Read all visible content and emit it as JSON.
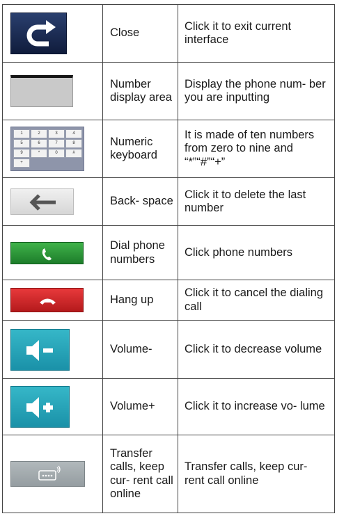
{
  "rows": [
    {
      "icon": "redo-arrow-icon",
      "name": "Close",
      "description": "Click it to exit current interface"
    },
    {
      "icon": "number-display-area-icon",
      "name": "Number display area",
      "description": "Display the phone num- ber you are inputting"
    },
    {
      "icon": "numeric-keypad-icon",
      "name": "Numeric keyboard",
      "description": "It is made of ten numbers from zero to nine and “*”“#”“+”"
    },
    {
      "icon": "backspace-arrow-icon",
      "name": "Back- space",
      "description": "Click it to delete the last number"
    },
    {
      "icon": "phone-icon",
      "name": "Dial phone numbers",
      "description": "Click phone numbers"
    },
    {
      "icon": "hang-up-icon",
      "name": "Hang up",
      "description": "Click it to cancel the dialing call"
    },
    {
      "icon": "volume-down-icon",
      "name": "Volume-",
      "description": "Click it to decrease volume"
    },
    {
      "icon": "volume-up-icon",
      "name": "Volume+",
      "description": "Click it to increase vo- lume"
    },
    {
      "icon": "transfer-call-icon",
      "name": "Transfer calls, keep cur- rent call online",
      "description": "Transfer calls, keep cur- rent call online"
    }
  ],
  "keypad": {
    "keys": [
      "1",
      "2",
      "3",
      "4",
      "5",
      "6",
      "7",
      "8",
      "9",
      "*",
      "0",
      "#",
      "+"
    ]
  },
  "colors": {
    "close": "#1a2a52",
    "dial": "#2e9a3a",
    "hangup": "#d0282a",
    "volume": "#27a6bb",
    "transfer": "#a3aaad",
    "border": "#444444"
  }
}
